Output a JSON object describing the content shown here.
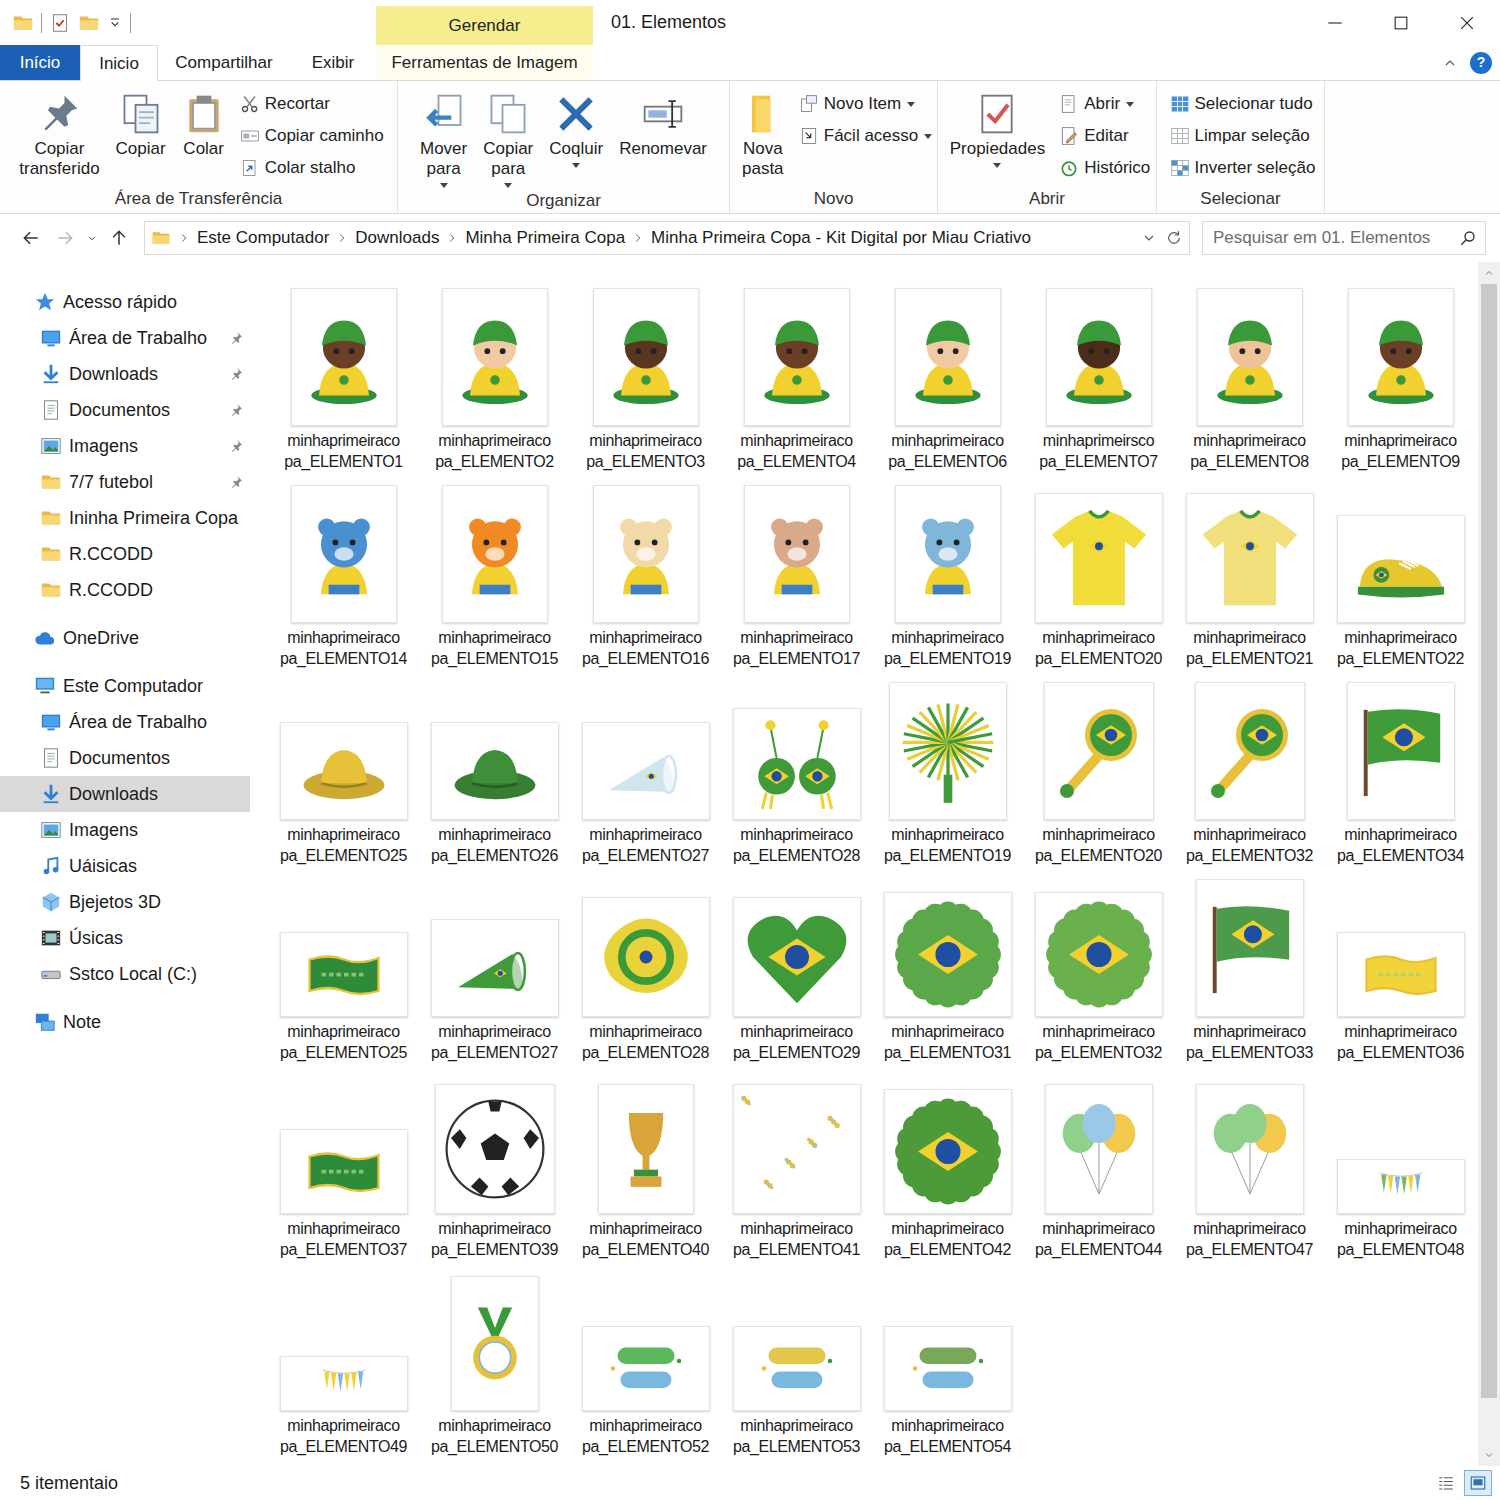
{
  "window": {
    "title": "01. Elementos",
    "context_tab": "Gerendar",
    "help": "?"
  },
  "tabs": [
    {
      "label": "Início",
      "kind": "file",
      "selected": false
    },
    {
      "label": "Inicio",
      "kind": "tab",
      "selected": true
    },
    {
      "label": "Compartilhar",
      "kind": "tab",
      "selected": false
    },
    {
      "label": "Exibir",
      "kind": "tab",
      "selected": false
    },
    {
      "label": "Ferramentas de Imagem",
      "kind": "context",
      "selected": false
    }
  ],
  "ribbon": {
    "groups": [
      {
        "label": "Área de Transferência",
        "items": [
          {
            "label": "Copiar transferido",
            "kind": "large",
            "dropdown": false
          },
          {
            "label": "Copiar",
            "kind": "large",
            "dropdown": false
          },
          {
            "label": "Colar",
            "kind": "large",
            "dropdown": false
          },
          {
            "label": "Recortar",
            "kind": "small",
            "dropdown": false
          },
          {
            "label": "Copiar caminho",
            "kind": "small",
            "dropdown": false
          },
          {
            "label": "Colar stalho",
            "kind": "small",
            "dropdown": false
          }
        ]
      },
      {
        "label": "Organizar",
        "items": [
          {
            "label": "Mover para",
            "kind": "large",
            "dropdown": true
          },
          {
            "label": "Copiar para",
            "kind": "large",
            "dropdown": true
          },
          {
            "label": "Coqluir",
            "kind": "large",
            "dropdown": true
          },
          {
            "label": "Renomevar",
            "kind": "large",
            "dropdown": false
          }
        ]
      },
      {
        "label": "Novo",
        "items": [
          {
            "label": "Nova pasta",
            "kind": "large",
            "dropdown": false
          },
          {
            "label": "Novo Item",
            "kind": "small",
            "dropdown": true
          },
          {
            "label": "Fácil acesso",
            "kind": "small",
            "dropdown": true
          }
        ]
      },
      {
        "label": "Abrir",
        "items": [
          {
            "label": "Propiedades",
            "kind": "large",
            "dropdown": true
          },
          {
            "label": "Abrir",
            "kind": "small",
            "dropdown": true
          },
          {
            "label": "Editar",
            "kind": "small",
            "dropdown": false
          },
          {
            "label": "Histórico",
            "kind": "small",
            "dropdown": false
          }
        ]
      },
      {
        "label": "Selecionar",
        "items": [
          {
            "label": "Selecionar tudo",
            "kind": "small",
            "dropdown": false
          },
          {
            "label": "Limpar seleção",
            "kind": "small",
            "dropdown": false
          },
          {
            "label": "Inverter seleção",
            "kind": "small",
            "dropdown": false
          }
        ]
      }
    ]
  },
  "nav": {
    "back": {
      "disabled": false
    },
    "forward": {
      "disabled": true
    },
    "up": {
      "disabled": false
    }
  },
  "address": {
    "crumbs": [
      "Este Computador",
      "Downloads",
      "Minha Primeira Copa",
      "Minha Primeira Copa - Kit Digital por Miau Criativo"
    ]
  },
  "search": {
    "placeholder": "Pesquisar em 01. Elementos"
  },
  "sidebar": {
    "items": [
      {
        "label": "Acesso rápido",
        "kind": "quick",
        "pinned": false,
        "selected": false
      },
      {
        "label": "Área de Trabalho",
        "kind": "desktop",
        "pinned": true,
        "selected": false
      },
      {
        "label": "Downloads",
        "kind": "downloads",
        "pinned": true,
        "selected": false
      },
      {
        "label": "Documentos",
        "kind": "documents",
        "pinned": true,
        "selected": false
      },
      {
        "label": "Imagens",
        "kind": "pictures",
        "pinned": true,
        "selected": false
      },
      {
        "label": "7/7 futebol",
        "kind": "folder",
        "pinned": true,
        "selected": false
      },
      {
        "label": "Ininha Primeira Copa",
        "kind": "folder",
        "pinned": false,
        "selected": false
      },
      {
        "label": "R.CCODD",
        "kind": "folder",
        "pinned": false,
        "selected": false
      },
      {
        "label": "R.CCODD",
        "kind": "folder",
        "pinned": false,
        "selected": false
      },
      {
        "label": "OneDrive",
        "kind": "cloud",
        "pinned": false,
        "selected": false
      },
      {
        "label": "Este Computador",
        "kind": "pc",
        "pinned": false,
        "selected": false
      },
      {
        "label": "Área de Trabalho",
        "kind": "desktop",
        "pinned": false,
        "selected": false
      },
      {
        "label": "Documentos",
        "kind": "documents",
        "pinned": false,
        "selected": false
      },
      {
        "label": "Downloads",
        "kind": "downloads",
        "pinned": false,
        "selected": true
      },
      {
        "label": "Imagens",
        "kind": "pictures",
        "pinned": false,
        "selected": false
      },
      {
        "label": "Uáisicas",
        "kind": "music",
        "pinned": false,
        "selected": false
      },
      {
        "label": "Bjejetos 3D",
        "kind": "objects",
        "pinned": false,
        "selected": false
      },
      {
        "label": "Úsicas",
        "kind": "videos",
        "pinned": false,
        "selected": false
      },
      {
        "label": "Sstco Local (C:)",
        "kind": "drive",
        "pinned": false,
        "selected": false
      },
      {
        "label": "Note",
        "kind": "network",
        "pinned": false,
        "selected": false
      }
    ]
  },
  "files": [
    {
      "name_lines": [
        "minhaprimeiraco",
        "pa_ELEMENTO1"
      ],
      "kind": "baby",
      "color": "#6b3f26"
    },
    {
      "name_lines": [
        "minhaprimeiraco",
        "pa_ELEMENTO2"
      ],
      "kind": "baby",
      "color": "#f1c9a5"
    },
    {
      "name_lines": [
        "minhaprimeiraco",
        "pa_ELEMENTO3"
      ],
      "kind": "baby",
      "color": "#5a3520"
    },
    {
      "name_lines": [
        "minhaprimeiraco",
        "pa_ELEMENTO4"
      ],
      "kind": "baby",
      "color": "#6b3f26"
    },
    {
      "name_lines": [
        "minhaprimeiraco",
        "pa_ELEMENTO6"
      ],
      "kind": "baby",
      "color": "#f1c9a5"
    },
    {
      "name_lines": [
        "minhaprimeirsco",
        "pa_ELEMENTO7"
      ],
      "kind": "baby",
      "color": "#4a2c1a"
    },
    {
      "name_lines": [
        "minhaprimeiraco",
        "pa_ELEMENTO8"
      ],
      "kind": "baby",
      "color": "#eec39a"
    },
    {
      "name_lines": [
        "minhaprimeiraco",
        "pa_ELEMENTO9"
      ],
      "kind": "baby",
      "color": "#6b3f26"
    },
    {
      "name_lines": [
        "minhaprimeiraco",
        "pa_ELEMENTO14"
      ],
      "kind": "animal",
      "color": "#4a8fd0"
    },
    {
      "name_lines": [
        "minhaprimeiraco",
        "pa_ELEMENTO15"
      ],
      "kind": "animal",
      "color": "#f08a24"
    },
    {
      "name_lines": [
        "minhaprimeiraco",
        "pa_ELEMENTO16"
      ],
      "kind": "animal",
      "color": "#f2d9a8"
    },
    {
      "name_lines": [
        "minhaprimeiraco",
        "pa_ELEMENTO17"
      ],
      "kind": "animal",
      "color": "#d9a98a"
    },
    {
      "name_lines": [
        "minhaprimeiraco",
        "pa_ELEMENTO19"
      ],
      "kind": "animal",
      "color": "#7fb6d9"
    },
    {
      "name_lines": [
        "minhaprimeiraco",
        "pa_ELEMENTO20"
      ],
      "kind": "shirt",
      "color": "#f2dc3a"
    },
    {
      "name_lines": [
        "minhaprimeiraco",
        "pa_ELEMENTO21"
      ],
      "kind": "shirt",
      "color": "#f0df7a"
    },
    {
      "name_lines": [
        "minhaprimeiraco",
        "pa_ELEMENTO22"
      ],
      "kind": "shoe",
      "color": "#e5c82e"
    },
    {
      "name_lines": [
        "minhaprimeiraco",
        "pa_ELEMENTO25"
      ],
      "kind": "hat",
      "color": "#e8c13a"
    },
    {
      "name_lines": [
        "minhaprimeiraco",
        "pa_ELEMENTO26"
      ],
      "kind": "hat",
      "color": "#3f8f3a"
    },
    {
      "name_lines": [
        "minhaprimeiraco",
        "pa_ELEMENTO27"
      ],
      "kind": "horn",
      "color": "#cfe6ef"
    },
    {
      "name_lines": [
        "minhaprimeiraco",
        "pa_ELEMENTO28"
      ],
      "kind": "glasses",
      "color": "#3f9b3a"
    },
    {
      "name_lines": [
        "minhaprimeiraco",
        "pa_ELEMENTO19"
      ],
      "kind": "pompom",
      "color": "#3f9b3a"
    },
    {
      "name_lines": [
        "minhaprimeiraco",
        "pa_ELEMENTO20"
      ],
      "kind": "rattle",
      "color": "#3f9b3a"
    },
    {
      "name_lines": [
        "minhaprimeiraco",
        "pa_ELEMENTO32"
      ],
      "kind": "rattle",
      "color": "#3f9b3a"
    },
    {
      "name_lines": [
        "minhaprimeiraco",
        "pa_ELEMENTO34"
      ],
      "kind": "flag",
      "color": "#3f9b3a"
    },
    {
      "name_lines": [
        "minhaprimeiraco",
        "pa_ELEMENTO25"
      ],
      "kind": "banner",
      "color": "#2e8b3a"
    },
    {
      "name_lines": [
        "minhaprimeiraco",
        "pa_ELEMENTO27"
      ],
      "kind": "horn",
      "color": "#3f9b3a"
    },
    {
      "name_lines": [
        "minhaprimeiraco",
        "pa_ELEMENTO28"
      ],
      "kind": "pacifier",
      "color": "#e8d33a"
    },
    {
      "name_lines": [
        "minhaprimeiraco",
        "pa_ELEMENTO29"
      ],
      "kind": "heart",
      "color": "#3f9b3a"
    },
    {
      "name_lines": [
        "minhaprimeiraco",
        "pa_ELEMENTO31"
      ],
      "kind": "wreath",
      "color": "#5aa84a"
    },
    {
      "name_lines": [
        "minhaprimeiraco",
        "pa_ELEMENTO32"
      ],
      "kind": "wreath",
      "color": "#6ab04c"
    },
    {
      "name_lines": [
        "minhaprimeiraco",
        "pa_ELEMENTO33"
      ],
      "kind": "flag",
      "color": "#4c9a4a"
    },
    {
      "name_lines": [
        "minhaprimeiraco",
        "pa_ELEMENTO36"
      ],
      "kind": "banner",
      "color": "#f2d43a"
    },
    {
      "name_lines": [
        "minhaprimeiraco",
        "pa_ELEMENTO37"
      ],
      "kind": "banner",
      "color": "#2e8b3a"
    },
    {
      "name_lines": [
        "minhaprimeiraco",
        "pa_ELEMENTO39"
      ],
      "kind": "ball",
      "color": "#ffffff"
    },
    {
      "name_lines": [
        "minhaprimeiraco",
        "pa_ELEMENTO40"
      ],
      "kind": "trophy",
      "color": "#d9a53a"
    },
    {
      "name_lines": [
        "minhaprimeiraco",
        "pa_ELEMENTO41"
      ],
      "kind": "confetti",
      "color": "#b9c47a"
    },
    {
      "name_lines": [
        "minhaprimeiraco",
        "pa_ELEMENTO42"
      ],
      "kind": "wreath",
      "color": "#4c9a3a"
    },
    {
      "name_lines": [
        "minhaprimeiraco",
        "pa_ELEMENTO44"
      ],
      "kind": "balloons",
      "color": "#9cc8e8"
    },
    {
      "name_lines": [
        "minhaprimeiraco",
        "pa_ELEMENTO47"
      ],
      "kind": "balloons",
      "color": "#8fd08a"
    },
    {
      "name_lines": [
        "minhaprimeiraco",
        "pa_ELEMENTO48"
      ],
      "kind": "bunting",
      "color": "#7cb65a"
    },
    {
      "name_lines": [
        "minhaprimeiraco",
        "pa_ELEMENTO49"
      ],
      "kind": "bunting",
      "color": "#f2d43a"
    },
    {
      "name_lines": [
        "minhaprimeiraco",
        "pa_ELEMENTO50"
      ],
      "kind": "medal",
      "color": "#e8c13a"
    },
    {
      "name_lines": [
        "minhaprimeiraco",
        "pa_ELEMENTO52"
      ],
      "kind": "lettering",
      "color": "#5cb85c"
    },
    {
      "name_lines": [
        "minhaprimeiraco",
        "pa_ELEMENTO53"
      ],
      "kind": "lettering",
      "color": "#e2c84a"
    },
    {
      "name_lines": [
        "minhaprimeiraco",
        "pa_ELEMENTO54"
      ],
      "kind": "lettering",
      "color": "#7aa85a"
    }
  ],
  "scrollbar": {
    "level": 0.96
  },
  "status_bar": {
    "text": "5 itementaio",
    "views": [
      {
        "kind": "details",
        "selected": false
      },
      {
        "kind": "large-icons",
        "selected": true
      }
    ]
  }
}
